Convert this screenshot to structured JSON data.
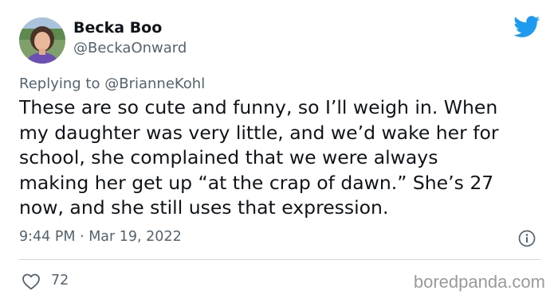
{
  "author": {
    "display_name": "Becka Boo",
    "handle": "@BeckaOnward"
  },
  "reply": {
    "prefix": "Replying to",
    "to_handle": "@BrianneKohl"
  },
  "tweet": {
    "lines": [
      "These are so cute and funny, so I’ll weigh in. When",
      "my daughter was very little, and we’d wake her for",
      "school, she complained that we were always",
      "making her get up “at the crap of dawn.” She’s 27",
      "now, and she still uses that expression."
    ],
    "timestamp": "9:44 PM · Mar 19, 2022"
  },
  "engagement": {
    "likes": "72"
  },
  "watermark": "boredpanda.com",
  "colors": {
    "twitter_blue": "#1d9bf0",
    "secondary_text": "#536471",
    "divider": "#cfd9de"
  },
  "icons": {
    "brand": "twitter-bird-icon",
    "info": "info-icon",
    "like": "heart-icon"
  }
}
